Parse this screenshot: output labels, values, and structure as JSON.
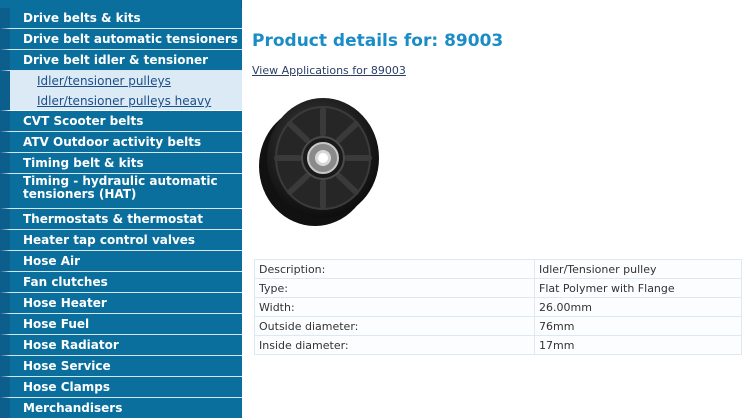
{
  "sidebar": {
    "items": [
      {
        "label": "Drive belts & kits",
        "type": "main"
      },
      {
        "label": "Drive belt automatic tensioners",
        "type": "main"
      },
      {
        "label": "Drive belt idler & tensioner pulleys",
        "type": "main"
      },
      {
        "label": "Idler/tensioner pulleys",
        "type": "sub"
      },
      {
        "label": "Idler/tensioner pulleys heavy duty",
        "type": "sub"
      },
      {
        "label": "CVT Scooter belts",
        "type": "main"
      },
      {
        "label": "ATV Outdoor activity belts",
        "type": "main"
      },
      {
        "label": "Timing belt & kits",
        "type": "main"
      },
      {
        "label": "Timing - hydraulic automatic tensioners (HAT)",
        "type": "main"
      },
      {
        "label": "Thermostats & thermostat gaskets",
        "type": "main"
      },
      {
        "label": "Heater tap control valves",
        "type": "main"
      },
      {
        "label": "Hose Air",
        "type": "main"
      },
      {
        "label": "Fan clutches",
        "type": "main"
      },
      {
        "label": "Hose Heater",
        "type": "main"
      },
      {
        "label": "Hose Fuel",
        "type": "main"
      },
      {
        "label": "Hose Radiator",
        "type": "main"
      },
      {
        "label": "Hose Service",
        "type": "main"
      },
      {
        "label": "Hose Clamps",
        "type": "main"
      },
      {
        "label": "Merchandisers",
        "type": "main"
      }
    ]
  },
  "main": {
    "title": "Product details for: 89003",
    "applications_link": "View Applications for 89003",
    "specs": [
      {
        "label": "Description:",
        "value": "Idler/Tensioner pulley"
      },
      {
        "label": "Type:",
        "value": "Flat Polymer with Flange"
      },
      {
        "label": "Width:",
        "value": "26.00mm"
      },
      {
        "label": "Outside diameter:",
        "value": "76mm"
      },
      {
        "label": "Inside diameter:",
        "value": "17mm"
      }
    ]
  },
  "colors": {
    "sidebar_bg": "#0b6f9e",
    "sub_bg": "#dceaf5",
    "title": "#1a8cc6"
  }
}
